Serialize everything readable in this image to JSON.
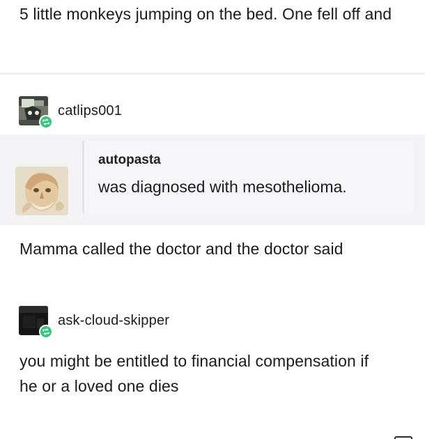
{
  "post": {
    "intro_text": "5 little monkeys jumping on the bed. One fell off and",
    "reblogs": [
      {
        "username": "catlips001",
        "avatar_icon": "cat-avatar-icon",
        "badge_icon": "reblog-icon"
      },
      {
        "username": "ask-cloud-skipper",
        "avatar_icon": "dark-avatar-icon",
        "badge_icon": "reblog-icon"
      }
    ],
    "quote": {
      "username": "autopasta",
      "text": "was diagnosed with mesothelioma.",
      "avatar_icon": "pasta-face-avatar-icon"
    },
    "middle_text": "Mamma called the doctor and the doctor said",
    "final_text": "you might be entitled to financial compensation if he or a loved one dies"
  },
  "colors": {
    "background": "#ffffff",
    "text": "#1b1b1b",
    "quote_band": "#f3f3f5",
    "quote_card": "#f6f6f8",
    "reblog_badge": "#34c77b",
    "separator": "#f0f0f0"
  }
}
